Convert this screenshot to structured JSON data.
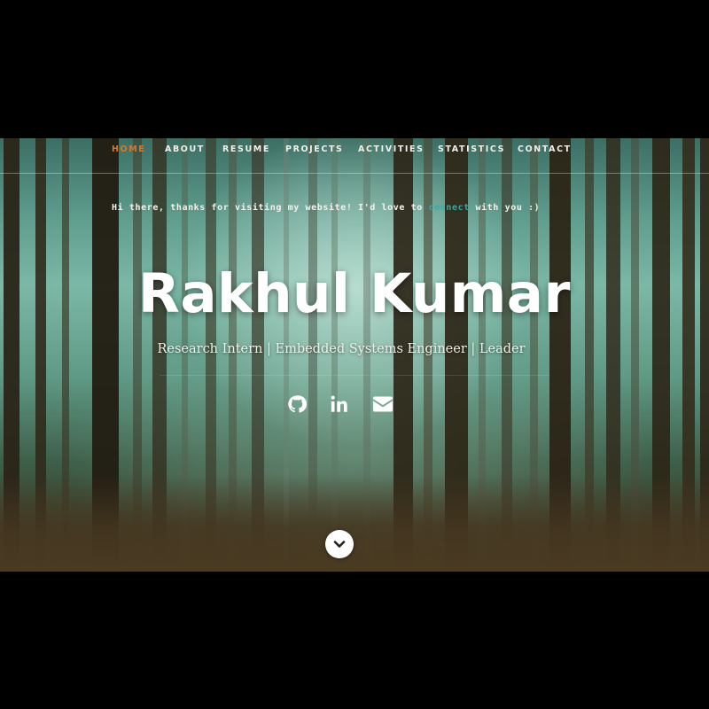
{
  "nav": {
    "items": [
      {
        "label": "HOME",
        "active": true
      },
      {
        "label": "ABOUT",
        "active": false
      },
      {
        "label": "RESUME",
        "active": false
      },
      {
        "label": "PROJECTS",
        "active": false
      },
      {
        "label": "ACTIVITIES",
        "active": false
      },
      {
        "label": "STATISTICS",
        "active": false
      },
      {
        "label": "CONTACT",
        "active": false
      }
    ]
  },
  "hero": {
    "greeting_before": "Hi there, thanks for visiting my website! I'd love to ",
    "greeting_link": "connect",
    "greeting_after": " with you :)",
    "name": "Rakhul Kumar",
    "tagline": "Research Intern | Embedded Systems Engineer | Leader"
  },
  "social": {
    "icons": [
      "github-icon",
      "linkedin-icon",
      "envelope-icon"
    ]
  },
  "scroll": {
    "icon": "chevron-down-icon"
  },
  "colors": {
    "accent": "#d8782a",
    "link": "#3aa9a0",
    "text": "#ffffff"
  }
}
